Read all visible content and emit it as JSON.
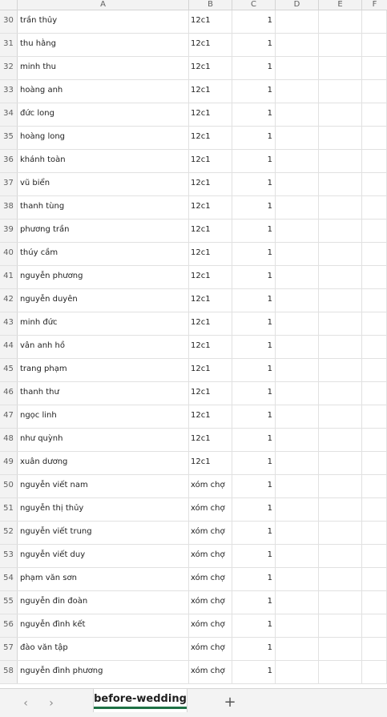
{
  "columns": [
    "A",
    "B",
    "C",
    "D",
    "E",
    "F"
  ],
  "rows": [
    {
      "n": "30",
      "a": "trần thủy",
      "b": "12c1",
      "c": "1"
    },
    {
      "n": "31",
      "a": "thu hằng",
      "b": "12c1",
      "c": "1"
    },
    {
      "n": "32",
      "a": "minh thu",
      "b": "12c1",
      "c": "1"
    },
    {
      "n": "33",
      "a": "hoàng anh",
      "b": "12c1",
      "c": "1"
    },
    {
      "n": "34",
      "a": "đức long",
      "b": "12c1",
      "c": "1"
    },
    {
      "n": "35",
      "a": "hoàng long",
      "b": "12c1",
      "c": "1"
    },
    {
      "n": "36",
      "a": "khánh toàn",
      "b": "12c1",
      "c": "1"
    },
    {
      "n": "37",
      "a": "vũ biển",
      "b": "12c1",
      "c": "1"
    },
    {
      "n": "38",
      "a": "thanh tùng",
      "b": "12c1",
      "c": "1"
    },
    {
      "n": "39",
      "a": "phương trần",
      "b": "12c1",
      "c": "1"
    },
    {
      "n": "40",
      "a": "thúy cầm",
      "b": "12c1",
      "c": "1"
    },
    {
      "n": "41",
      "a": "nguyễn phương",
      "b": "12c1",
      "c": "1"
    },
    {
      "n": "42",
      "a": "nguyễn duyên",
      "b": "12c1",
      "c": "1"
    },
    {
      "n": "43",
      "a": "minh đức",
      "b": "12c1",
      "c": "1"
    },
    {
      "n": "44",
      "a": "vân anh hồ",
      "b": "12c1",
      "c": "1"
    },
    {
      "n": "45",
      "a": "trang phạm",
      "b": "12c1",
      "c": "1"
    },
    {
      "n": "46",
      "a": "thanh thư",
      "b": "12c1",
      "c": "1"
    },
    {
      "n": "47",
      "a": "ngọc linh",
      "b": "12c1",
      "c": "1"
    },
    {
      "n": "48",
      "a": "như quỳnh",
      "b": "12c1",
      "c": "1"
    },
    {
      "n": "49",
      "a": "xuân dương",
      "b": "12c1",
      "c": "1"
    },
    {
      "n": "50",
      "a": "nguyễn viết nam",
      "b": "xóm chợ",
      "c": "1"
    },
    {
      "n": "51",
      "a": "nguyễn thị thủy",
      "b": "xóm chợ",
      "c": "1"
    },
    {
      "n": "52",
      "a": "nguyễn viết trung",
      "b": "xóm chợ",
      "c": "1"
    },
    {
      "n": "53",
      "a": "nguyễn viết duy",
      "b": "xóm chợ",
      "c": "1"
    },
    {
      "n": "54",
      "a": "phạm văn sơn",
      "b": "xóm chợ",
      "c": "1"
    },
    {
      "n": "55",
      "a": "nguyễn đin đoàn",
      "b": "xóm chợ",
      "c": "1"
    },
    {
      "n": "56",
      "a": "nguyễn đình kết",
      "b": "xóm chợ",
      "c": "1"
    },
    {
      "n": "57",
      "a": "đào văn tập",
      "b": "xóm chợ",
      "c": "1"
    },
    {
      "n": "58",
      "a": "nguyễn đình phương",
      "b": "xóm chợ",
      "c": "1"
    }
  ],
  "tabs": {
    "prev_icon": "chevron-left-icon",
    "next_icon": "chevron-right-icon",
    "active_sheet": "before-wedding",
    "add_icon": "plus-icon",
    "accent_color": "#1e7145"
  }
}
